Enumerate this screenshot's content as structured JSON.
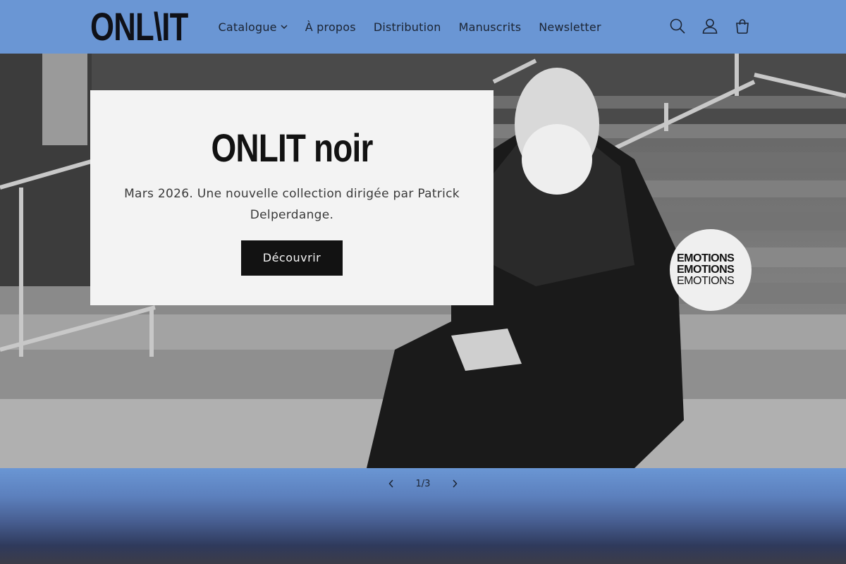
{
  "header": {
    "logo_text": "ONL\\IT",
    "nav": [
      {
        "label": "Catalogue",
        "has_dropdown": true
      },
      {
        "label": "À propos"
      },
      {
        "label": "Distribution"
      },
      {
        "label": "Manuscrits"
      },
      {
        "label": "Newsletter"
      }
    ],
    "icons": [
      "search-icon",
      "account-icon",
      "cart-icon"
    ]
  },
  "hero": {
    "title": "ONLIT noir",
    "text": "Mars 2026. Une nouvelle collection dirigée par Patrick Delperdange.",
    "button_label": "Découvrir",
    "badge_lines": [
      "EMOTIONS",
      "EMOTIONS",
      "EMOTIONS"
    ]
  },
  "slider": {
    "counter": "1/3",
    "current": 1,
    "total": 3
  },
  "colors": {
    "header_bg": "#6a96d4",
    "card_bg": "#f3f3f3",
    "button_bg": "#121212"
  }
}
